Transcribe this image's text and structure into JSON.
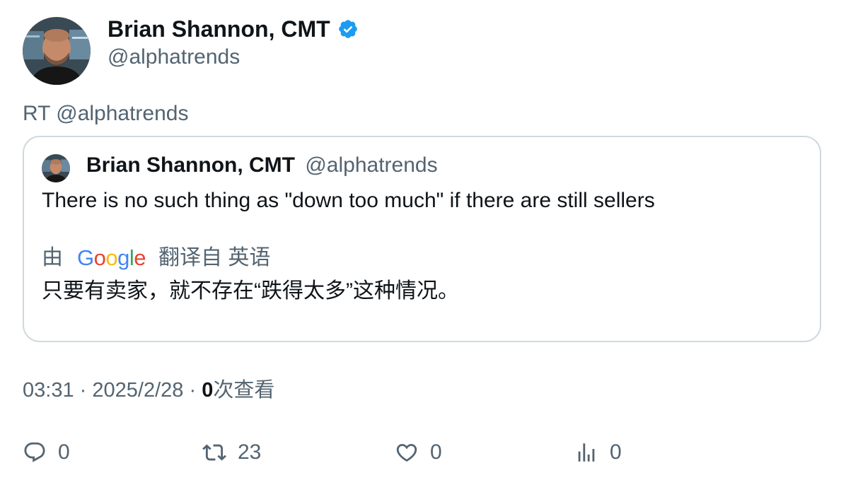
{
  "author": {
    "display_name": "Brian Shannon, CMT",
    "handle": "@alphatrends",
    "verified": true
  },
  "retweet_label": "RT @alphatrends",
  "quote": {
    "display_name": "Brian Shannon, CMT",
    "handle": "@alphatrends",
    "text": "There is no such thing as \"down too much\" if there are still sellers",
    "translation": {
      "prefix": "由",
      "provider_letters": [
        "G",
        "o",
        "o",
        "g",
        "l",
        "e"
      ],
      "suffix": "翻译自 英语",
      "text": "只要有卖家，就不存在“跌得太多”这种情况。"
    }
  },
  "meta": {
    "time": "03:31",
    "separator": "·",
    "date": "2025/2/28",
    "views_count": "0",
    "views_label": "次查看"
  },
  "actions": {
    "replies": "0",
    "retweets": "23",
    "likes": "0",
    "views": "0"
  },
  "colors": {
    "verified_badge": "#1d9bf0",
    "secondary_text": "#536471",
    "card_border": "#cfd9de"
  },
  "icons": [
    "verified-badge-icon",
    "reply-icon",
    "retweet-icon",
    "like-icon",
    "views-icon"
  ]
}
